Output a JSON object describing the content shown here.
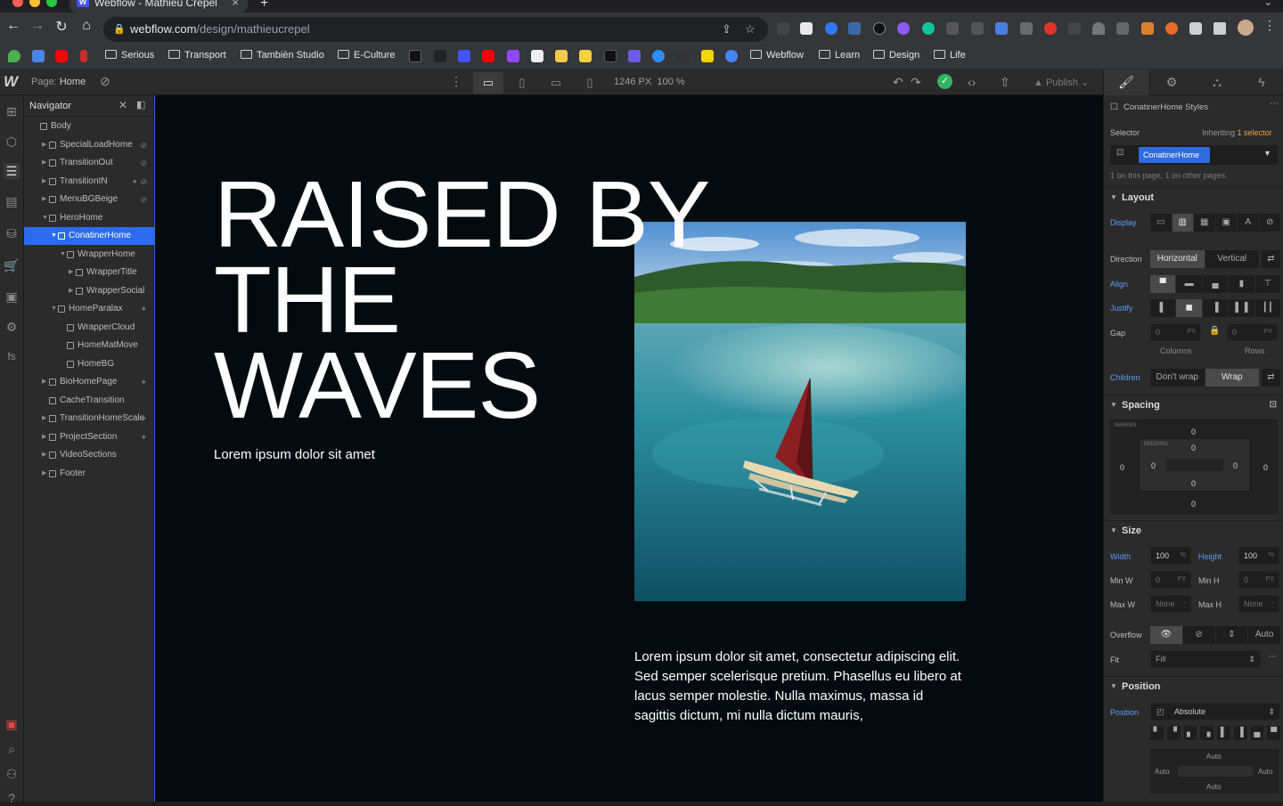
{
  "browser": {
    "tab_title": "Webflow - Mathieu Crepel",
    "tab_icon_letter": "W",
    "url_host": "webflow.com",
    "url_path": "/design/mathieucrepel",
    "bookmarks": [
      "Serious",
      "Transport",
      "Tambièn Studio",
      "E-Culture",
      "Webflow",
      "Learn",
      "Design",
      "Life"
    ]
  },
  "designer": {
    "page_label": "Page:",
    "page_name": "Home",
    "canvas_width": "1246 PX",
    "zoom": "100 %",
    "publish_label": "Publish"
  },
  "navigator": {
    "title": "Navigator",
    "items": [
      {
        "label": "Body",
        "depth": 0,
        "caret": false,
        "selected": false,
        "icon": ""
      },
      {
        "label": "SpecialLoadHome",
        "depth": 1,
        "caret": true,
        "selected": false,
        "icon": "hidden-icon"
      },
      {
        "label": "TransitionOut",
        "depth": 1,
        "caret": true,
        "selected": false,
        "icon": "hidden-icon"
      },
      {
        "label": "TransitionIN",
        "depth": 1,
        "caret": true,
        "selected": false,
        "icon": "interaction-icon hidden-icon"
      },
      {
        "label": "MenuBGBeige",
        "depth": 1,
        "caret": true,
        "selected": false,
        "icon": "hidden-icon"
      },
      {
        "label": "HeroHome",
        "depth": 1,
        "caret": "open",
        "selected": false,
        "icon": ""
      },
      {
        "label": "ConatinerHome",
        "depth": 2,
        "caret": "open",
        "selected": true,
        "icon": ""
      },
      {
        "label": "WrapperHome",
        "depth": 3,
        "caret": "open",
        "selected": false,
        "icon": ""
      },
      {
        "label": "WrapperTitle",
        "depth": 4,
        "caret": true,
        "selected": false,
        "icon": ""
      },
      {
        "label": "WrapperSocial",
        "depth": 4,
        "caret": true,
        "selected": false,
        "icon": ""
      },
      {
        "label": "HomeParalax",
        "depth": 2,
        "caret": "open",
        "selected": false,
        "icon": "interaction-icon"
      },
      {
        "label": "WrapperCloud",
        "depth": 3,
        "caret": false,
        "selected": false,
        "icon": ""
      },
      {
        "label": "HomeMatMove",
        "depth": 3,
        "caret": false,
        "selected": false,
        "icon": ""
      },
      {
        "label": "HomeBG",
        "depth": 3,
        "caret": false,
        "selected": false,
        "icon": ""
      },
      {
        "label": "BioHomePage",
        "depth": 1,
        "caret": true,
        "selected": false,
        "icon": "interaction-icon"
      },
      {
        "label": "CacheTransition",
        "depth": 1,
        "caret": false,
        "selected": false,
        "icon": ""
      },
      {
        "label": "TransitionHomeScale",
        "depth": 1,
        "caret": true,
        "selected": false,
        "icon": "interaction-icon"
      },
      {
        "label": "ProjectSection",
        "depth": 1,
        "caret": true,
        "selected": false,
        "icon": "interaction-icon"
      },
      {
        "label": "VideoSections",
        "depth": 1,
        "caret": true,
        "selected": false,
        "icon": ""
      },
      {
        "label": "Footer",
        "depth": 1,
        "caret": true,
        "selected": false,
        "icon": ""
      }
    ]
  },
  "canvas": {
    "headline": "RAISED BY THE WAVES",
    "tagline": "Lorem ipsum dolor sit amet",
    "body_text": "Lorem ipsum dolor sit amet, consectetur adipiscing elit. Sed semper scelerisque pretium. Phasellus eu libero at lacus semper molestie. Nulla maximus, massa id sagittis dictum, mi nulla dictum mauris,"
  },
  "style_panel": {
    "element_title": "ConatinerHome Styles",
    "selector_label": "Selector",
    "inheriting_prefix": "Inheriting",
    "inheriting_count": "1 selector",
    "selector_value": "ConatinerHome",
    "selector_usage": "1 on this page, 1 on other pages.",
    "layout": {
      "title": "Layout",
      "display_label": "Display",
      "direction_label": "Direction",
      "direction_horizontal": "Horizontal",
      "direction_vertical": "Vertical",
      "align_label": "Align",
      "justify_label": "Justify",
      "gap_label": "Gap",
      "gap_columns": "0",
      "gap_rows": "0",
      "gap_unit": "PX",
      "columns_label": "Columns",
      "rows_label": "Rows",
      "children_label": "Children",
      "children_nowrap": "Don't wrap",
      "children_wrap": "Wrap"
    },
    "spacing": {
      "title": "Spacing",
      "margin_label": "MARGIN",
      "padding_label": "PADDING",
      "margin_top": "0",
      "margin_left": "0",
      "margin_right": "0",
      "margin_bottom": "0",
      "padding_top": "0",
      "padding_left": "0",
      "padding_right": "0",
      "padding_bottom": "0"
    },
    "size": {
      "title": "Size",
      "width_label": "Width",
      "width_value": "100",
      "width_unit": "%",
      "height_label": "Height",
      "height_value": "100",
      "height_unit": "%",
      "minw_label": "Min W",
      "minw_value": "0",
      "minw_unit": "PX",
      "minh_label": "Min H",
      "minh_value": "0",
      "minh_unit": "PX",
      "maxw_label": "Max W",
      "maxw_value": "None",
      "maxw_unit": "-",
      "maxh_label": "Max H",
      "maxh_value": "None",
      "maxh_unit": "-",
      "overflow_label": "Overflow",
      "overflow_auto": "Auto",
      "fit_label": "Fit",
      "fit_value": "Fill"
    },
    "position": {
      "title": "Position",
      "position_label": "Position",
      "position_value": "Absolute",
      "top": "Auto",
      "left": "Auto",
      "right": "Auto",
      "bottom": "Auto"
    }
  }
}
